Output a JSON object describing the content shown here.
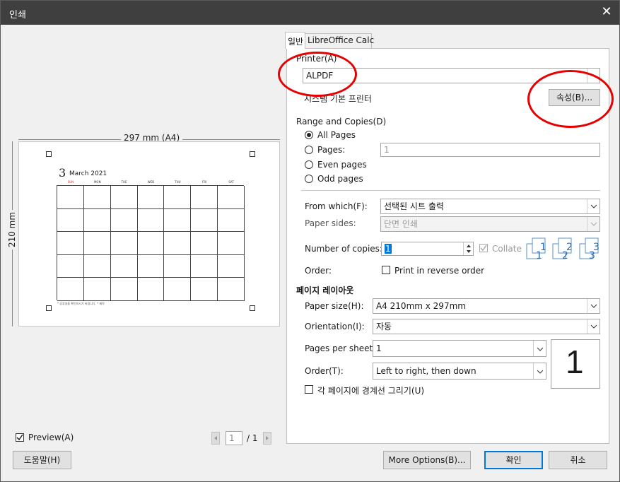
{
  "window": {
    "title": "인쇄",
    "close_glyph": "✕"
  },
  "preview": {
    "width_label": "297 mm (A4)",
    "height_label": "210 mm",
    "calendar_day": "3",
    "calendar_month": "March 2021",
    "weekdays": [
      "SUN",
      "MON",
      "TUE",
      "WED",
      "THU",
      "FRI",
      "SAT"
    ],
    "footer_note": "* 공휴일을 확인하시기 바랍니다. * 제작",
    "checkbox_label": "Preview(A)",
    "page_value": "1",
    "page_total": "/ 1"
  },
  "tabs": [
    {
      "label": "일반"
    },
    {
      "label": "LibreOffice Calc"
    }
  ],
  "printer": {
    "section_label": "Printer(A)",
    "selected": "ALPDF",
    "status_text": "시스템 기본 프린터",
    "properties_button": "속성(B)..."
  },
  "range": {
    "section_label": "Range and Copies(D)",
    "options": [
      "All Pages",
      "Pages:",
      "Even pages",
      "Odd pages"
    ],
    "selected_index": 0,
    "pages_value": "1"
  },
  "settings": {
    "from_which_label": "From which(F):",
    "from_which_value": "선택된 시트 출력",
    "paper_sides_label": "Paper sides:",
    "paper_sides_value": "단면 인쇄",
    "copies_label": "Number of copies:",
    "copies_value": "1",
    "collate_label": "Collate",
    "order_label": "Order:",
    "reverse_label": "Print in reverse order"
  },
  "layout": {
    "section_label": "페이지 레이아웃",
    "paper_size_label": "Paper size(H):",
    "paper_size_value": "A4 210mm x 297mm",
    "orientation_label": "Orientation(I):",
    "orientation_value": "자동",
    "pages_per_sheet_label": "Pages per sheet:",
    "pages_per_sheet_value": "1",
    "order_label": "Order(T):",
    "order_value": "Left to right, then down",
    "border_label": "각 페이지에 경계선 그리기(U)",
    "preview_number": "1"
  },
  "buttons": {
    "help": "도움말(H)",
    "more_options": "More Options(B)...",
    "ok": "확인",
    "cancel": "취소"
  },
  "colors": {
    "annotation": "#e60000",
    "accent": "#0078d7",
    "titlebar": "#3f3f3f"
  }
}
